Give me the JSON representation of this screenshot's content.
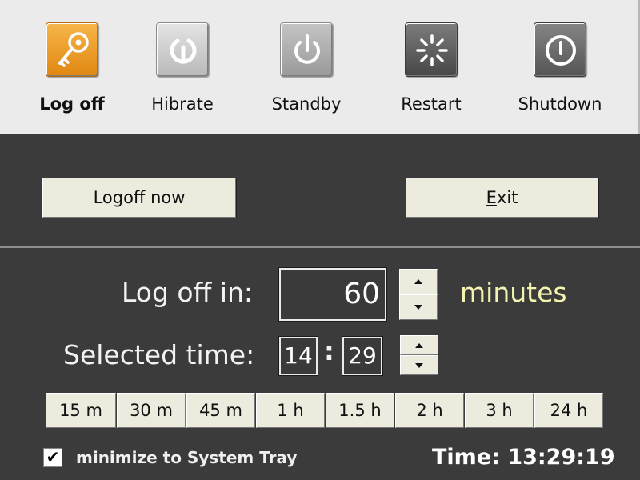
{
  "actions": [
    {
      "label": "Log off",
      "icon": "key-icon",
      "active": true
    },
    {
      "label": "Hibrate",
      "icon": "hibernate-icon",
      "active": false
    },
    {
      "label": "Standby",
      "icon": "standby-icon",
      "active": false
    },
    {
      "label": "Restart",
      "icon": "restart-icon",
      "active": false
    },
    {
      "label": "Shutdown",
      "icon": "shutdown-icon",
      "active": false
    }
  ],
  "buttons": {
    "action_now": "Logoff now",
    "exit": "Exit"
  },
  "countdown": {
    "label": "Log off in:",
    "value": "60",
    "unit": "minutes"
  },
  "selected_time": {
    "label": "Selected time:",
    "hour": "14",
    "separator": ":",
    "minute": "29"
  },
  "presets": [
    "15 m",
    "30 m",
    "45 m",
    "1 h",
    "1.5 h",
    "2 h",
    "3 h",
    "24 h"
  ],
  "footer": {
    "minimize_label": "minimize to System Tray",
    "minimize_checked": true,
    "clock": "Time: 13:29:19"
  },
  "colors": {
    "accent_unit": "#f4f4b0",
    "active_icon": "#e8961f",
    "panel": "#3b3b3b"
  }
}
